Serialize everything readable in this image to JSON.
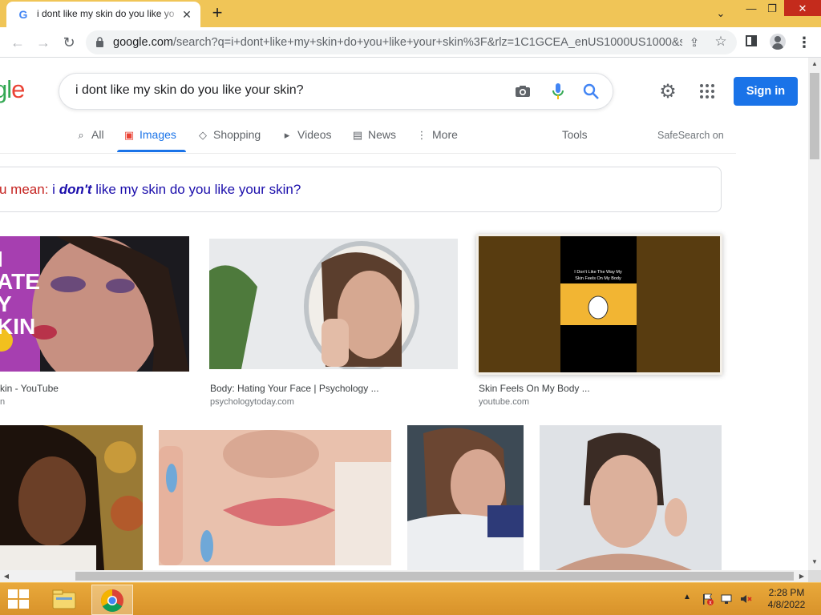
{
  "browser": {
    "tab_title": "i dont like my skin do you like yo",
    "tab_favicon": "G",
    "url_host": "google.com",
    "url_rest": "/search?q=i+dont+like+my+skin+do+you+like+your+skin%3F&rlz=1C1GCEA_enUS1000US1000&s..."
  },
  "header": {
    "logo_text": "gle",
    "search_query": "i dont like my skin do you like your skin?",
    "sign_in_label": "Sign in"
  },
  "tabs": {
    "all": "All",
    "images": "Images",
    "shopping": "Shopping",
    "videos": "Videos",
    "news": "News",
    "more": "More",
    "tools": "Tools",
    "safesearch": "SafeSearch on"
  },
  "did_you_mean": {
    "prefix": "u mean:",
    "query_before": "i",
    "query_bold": "don't",
    "query_after": "like my skin do you like your skin?"
  },
  "results": [
    {
      "caption": "kin - YouTube",
      "source": "n"
    },
    {
      "caption": "Body: Hating Your Face | Psychology ...",
      "source": "psychologytoday.com"
    },
    {
      "caption": "Skin Feels On My Body ...",
      "source": "youtube.com",
      "thumb_text": "I Don't Like The Way My Skin Feels On My Body"
    },
    {
      "thumb_overlay_text": "I\nATE\nY\nKIN"
    }
  ],
  "taskbar": {
    "time": "2:28 PM",
    "date": "4/8/2022"
  },
  "colors": {
    "accent": "#1a73e8",
    "titlebar": "#f0c557",
    "taskbar": "#e0a03a",
    "dym_prefix": "#c5221f",
    "link": "#1a0dab"
  },
  "icons": [
    "google-favicon-icon",
    "close-icon",
    "plus-icon",
    "chevron-down-icon",
    "minimize-icon",
    "restore-icon",
    "back-arrow-icon",
    "forward-arrow-icon",
    "reload-icon",
    "lock-icon",
    "share-icon",
    "star-icon",
    "side-panel-icon",
    "profile-icon",
    "kebab-menu-icon",
    "camera-icon",
    "mic-icon",
    "search-icon",
    "gear-icon",
    "apps-grid-icon",
    "windows-start-icon",
    "file-explorer-icon",
    "chrome-icon"
  ]
}
